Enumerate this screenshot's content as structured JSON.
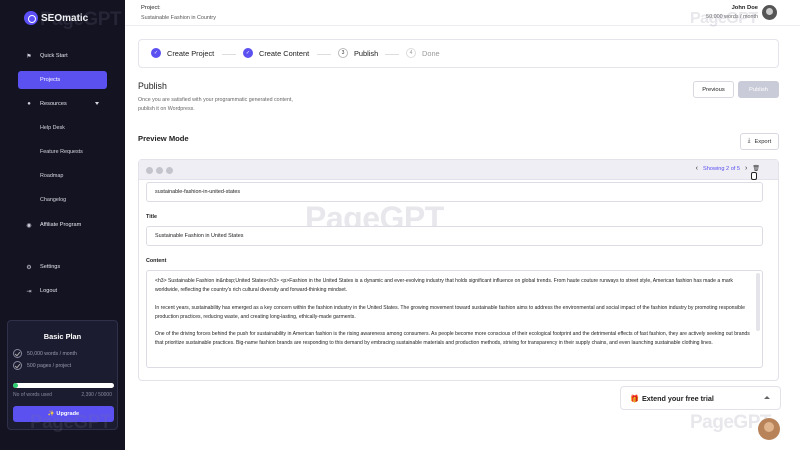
{
  "brand": {
    "name": "SEOmatic",
    "watermark": "PageGPT"
  },
  "sidebar": {
    "items": [
      {
        "label": "Quick Start",
        "icon": "flag-icon"
      },
      {
        "label": "Projects",
        "icon": "folder-icon"
      },
      {
        "label": "Resources",
        "icon": "info-icon"
      }
    ],
    "resources_sub": [
      "Help Desk",
      "Feature Requests",
      "Roadmap",
      "Changelog"
    ],
    "affiliate": "Affiliate Program",
    "settings": "Settings",
    "logout": "Logout"
  },
  "plan": {
    "title": "Basic Plan",
    "features": [
      "50,000 words / month",
      "500 pages / project"
    ],
    "usage_label": "No of words used",
    "usage_count": "2,390 / 50000",
    "usage_fraction": 0.048,
    "upgrade_label": "✨ Upgrade"
  },
  "header": {
    "project_label": "Project:",
    "project_name": "Sustainable Fashion in Country",
    "user_name": "John Doe",
    "user_words": "50,000 words / month"
  },
  "steps": [
    {
      "label": "Create Project",
      "marker": "",
      "state": "done"
    },
    {
      "label": "Create Content",
      "marker": "",
      "state": "done"
    },
    {
      "label": "Publish",
      "marker": "3",
      "state": "current"
    },
    {
      "label": "Done",
      "marker": "4",
      "state": "todo"
    }
  ],
  "publish": {
    "title": "Publish",
    "description": "Once you are satisfied with your programmatic generated content, publish it on Wordpress.",
    "previous_label": "Previous",
    "publish_label": "Publish"
  },
  "preview": {
    "title": "Preview Mode",
    "export_label": "Export",
    "pager": "Showing 2 of 5",
    "slug": "sustainable-fashion-in-united-states",
    "title_label": "Title",
    "title_value": "Sustainable Fashion in United States",
    "content_label": "Content",
    "content_paragraphs": [
      "<h3> Sustainable Fashion in&nbsp;United States</h3> <p>Fashion in the United States is a dynamic and ever-evolving industry that holds significant influence on global trends. From haute couture runways to street style, American fashion has made a mark worldwide, reflecting the country's rich cultural diversity and forward-thinking mindset.",
      "In recent years, sustainability has emerged as a key concern within the fashion industry in the United States. The growing movement toward sustainable fashion aims to address the environmental and social impact of the fashion industry by promoting responsible production practices, reducing waste, and creating long-lasting, ethically-made garments.",
      "One of the driving forces behind the push for sustainability in American fashion is the rising awareness among consumers. As people become more conscious of their ecological footprint and the detrimental effects of fast fashion, they are actively seeking out brands that prioritize sustainable practices. Big-name fashion brands are responding to this demand by embracing sustainable materials and production methods, striving for transparency in their supply chains, and even launching sustainable clothing lines."
    ]
  },
  "trial": {
    "label": "Extend your free trial"
  }
}
